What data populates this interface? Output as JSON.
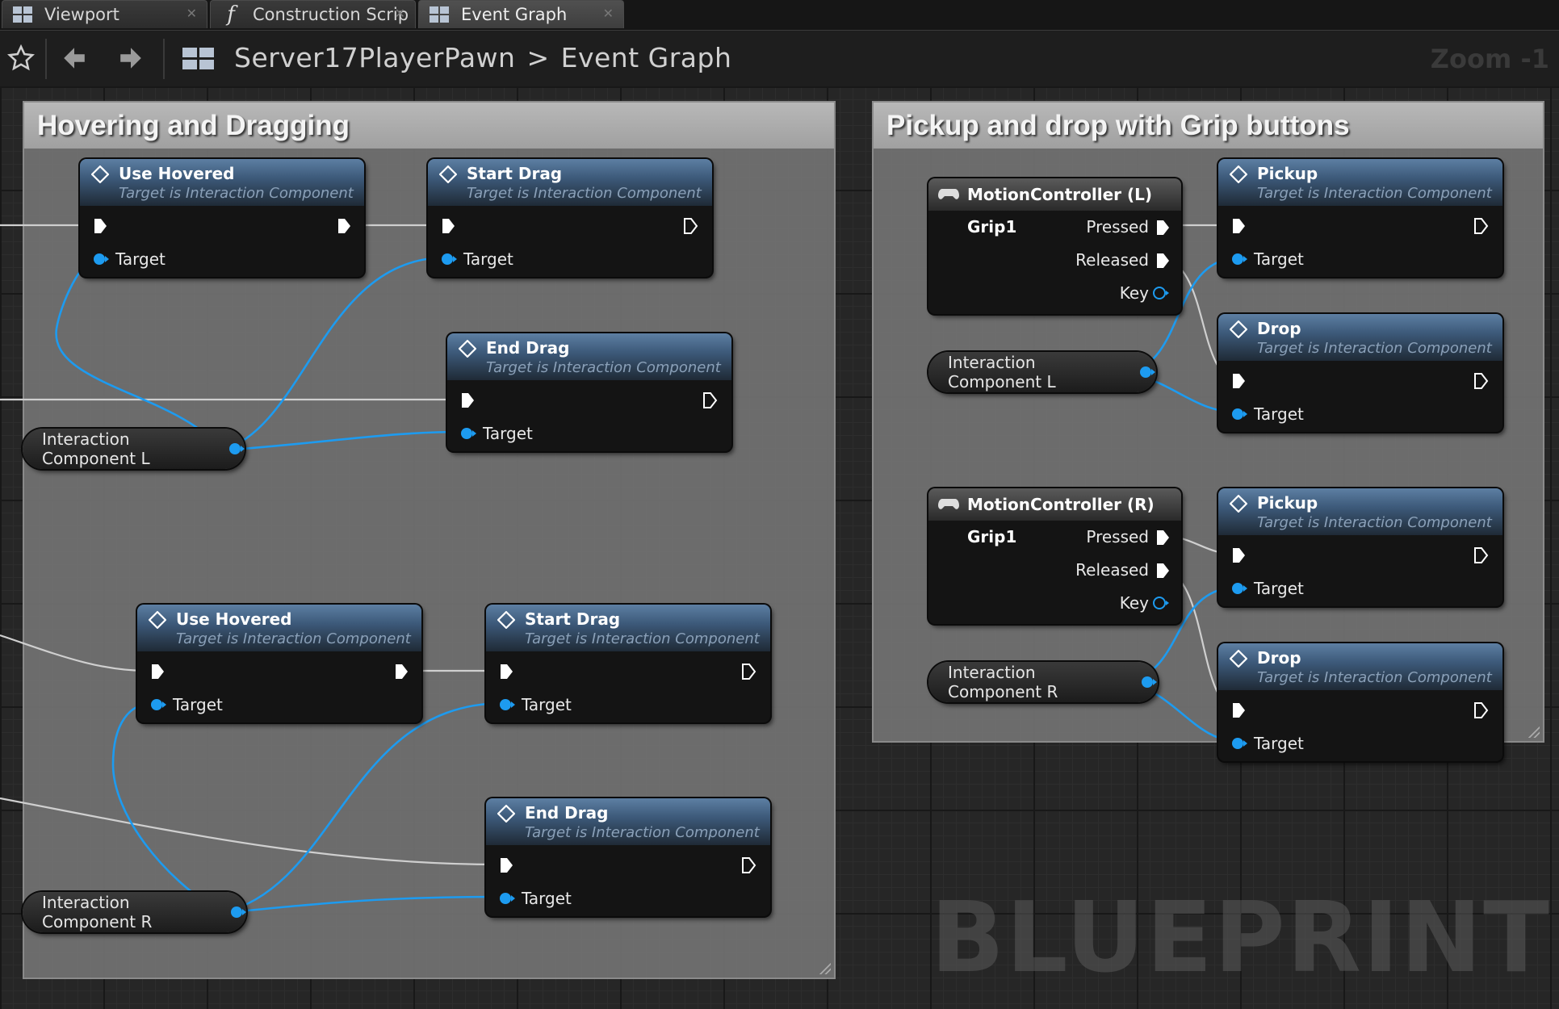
{
  "tabs": [
    {
      "label": "Viewport",
      "icon": "viewport-grid-icon"
    },
    {
      "label": "Construction Scrip",
      "icon": "function-icon"
    },
    {
      "label": "Event Graph",
      "icon": "event-graph-icon"
    }
  ],
  "breadcrumb": {
    "blueprint": "Server17PlayerPawn",
    "separator": ">",
    "graph": "Event Graph"
  },
  "zoom_label": "Zoom -1",
  "watermark": "BLUEPRINT",
  "comments": {
    "left": {
      "title": "Hovering and Dragging"
    },
    "right": {
      "title": "Pickup and drop with Grip buttons"
    }
  },
  "nodes": {
    "use_hovered_1": {
      "title": "Use Hovered",
      "subtitle": "Target is Interaction Component",
      "pin": "Target"
    },
    "start_drag_1": {
      "title": "Start Drag",
      "subtitle": "Target is Interaction Component",
      "pin": "Target"
    },
    "end_drag_1": {
      "title": "End Drag",
      "subtitle": "Target is Interaction Component",
      "pin": "Target"
    },
    "use_hovered_2": {
      "title": "Use Hovered",
      "subtitle": "Target is Interaction Component",
      "pin": "Target"
    },
    "start_drag_2": {
      "title": "Start Drag",
      "subtitle": "Target is Interaction Component",
      "pin": "Target"
    },
    "end_drag_2": {
      "title": "End Drag",
      "subtitle": "Target is Interaction Component",
      "pin": "Target"
    },
    "pickup_l": {
      "title": "Pickup",
      "subtitle": "Target is Interaction Component",
      "pin": "Target"
    },
    "drop_l": {
      "title": "Drop",
      "subtitle": "Target is Interaction Component",
      "pin": "Target"
    },
    "pickup_r": {
      "title": "Pickup",
      "subtitle": "Target is Interaction Component",
      "pin": "Target"
    },
    "drop_r": {
      "title": "Drop",
      "subtitle": "Target is Interaction Component",
      "pin": "Target"
    }
  },
  "variables": {
    "left_l": "Interaction Component L",
    "left_r": "Interaction Component R",
    "right_l": "Interaction Component L",
    "right_r": "Interaction Component R"
  },
  "events": {
    "grip_l": {
      "title": "MotionController (L) Grip1",
      "pressed": "Pressed",
      "released": "Released",
      "key": "Key"
    },
    "grip_r": {
      "title": "MotionController (R) Grip1",
      "pressed": "Pressed",
      "released": "Released",
      "key": "Key"
    }
  },
  "colors": {
    "object_pin": "#1d9bf0",
    "exec_wire": "#d0d0d0"
  }
}
